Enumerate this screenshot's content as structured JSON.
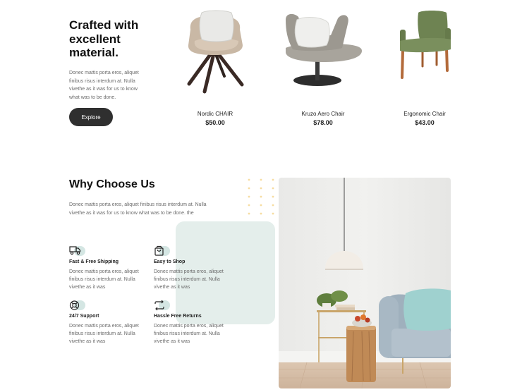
{
  "hero": {
    "title": "Crafted with excellent material.",
    "text": "Donec mattis porta eros, aliquet finibus risus interdum at. Nulla vivethe as it was for us to know what was to be done.",
    "button": "Explore"
  },
  "products": [
    {
      "name": "Nordic CHAIR",
      "price": "$50.00"
    },
    {
      "name": "Kruzo Aero Chair",
      "price": "$78.00"
    },
    {
      "name": "Ergonomic Chair",
      "price": "$43.00"
    }
  ],
  "why": {
    "title": "Why Choose Us",
    "text": "Donec mattis porta eros, aliquet finibus risus interdum at. Nulla vivethe as it was for us to know what was to be done. the",
    "features": [
      {
        "icon": "truck-icon",
        "title": "Fast & Free Shipping",
        "text": "Donec mattis porta eros, aliquet finibus risus interdum at. Nulla vivethe as it was"
      },
      {
        "icon": "shopping-bag-icon",
        "title": "Easy to Shop",
        "text": "Donec mattis porta eros, aliquet finibus risus interdum at. Nulla vivethe as it was"
      },
      {
        "icon": "support-icon",
        "title": "24/7 Support",
        "text": "Donec mattis porta eros, aliquet finibus risus interdum at. Nulla vivethe as it was"
      },
      {
        "icon": "return-arrows-icon",
        "title": "Hassle Free Returns",
        "text": "Donec mattis porta eros, aliquet finibus risus interdum at. Nulla vivethe as it was"
      }
    ]
  },
  "colors": {
    "button_bg": "#2f2f2f",
    "mint": "#e4eeeb",
    "icon_bubble": "#d4e6e3",
    "dot_accent": "#f6dca0"
  }
}
